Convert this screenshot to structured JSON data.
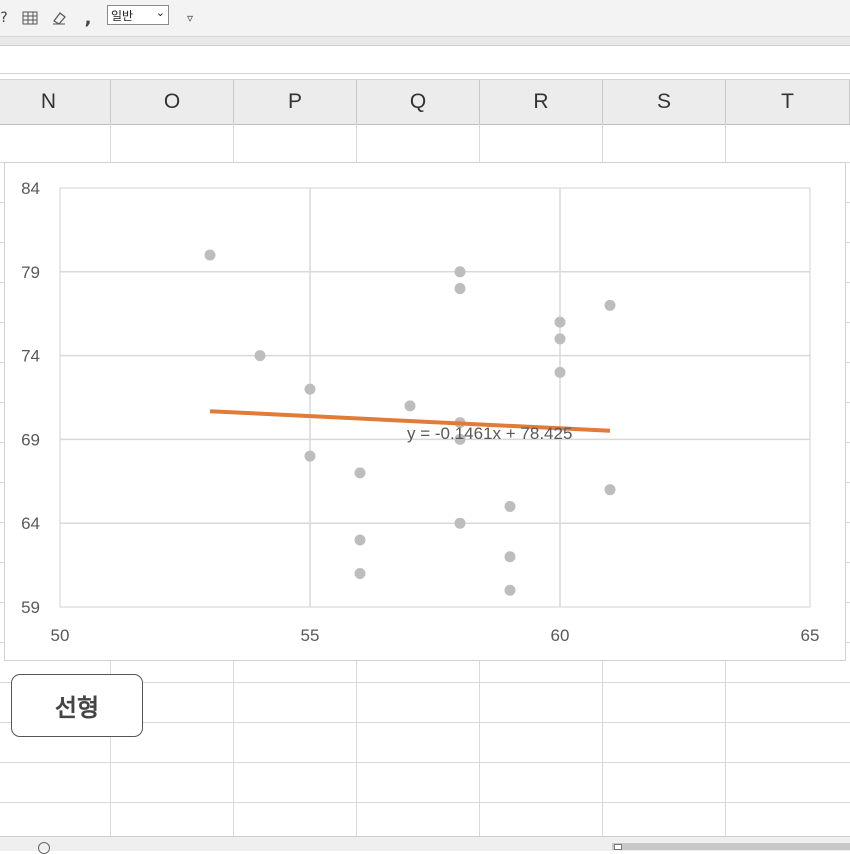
{
  "toolbar": {
    "icons": [
      "help-icon",
      "format-table-icon",
      "eraser-icon",
      "comma-style-icon"
    ],
    "comma_glyph": ",",
    "number_format": "일반",
    "more_icon": "▿"
  },
  "columns": [
    "N",
    "O",
    "P",
    "Q",
    "R",
    "S",
    "T"
  ],
  "button": {
    "label": "선형"
  },
  "chart_data": {
    "type": "scatter",
    "x_ticks": [
      "50",
      "55",
      "60",
      "65"
    ],
    "y_ticks": [
      "84",
      "79",
      "74",
      "69",
      "64",
      "59"
    ],
    "xlim": [
      50,
      65
    ],
    "ylim": [
      59,
      84
    ],
    "grid": true,
    "point_color": "#bdbdbd",
    "trendline_color": "#e07b39",
    "points": [
      {
        "x": 53,
        "y": 80
      },
      {
        "x": 54,
        "y": 74
      },
      {
        "x": 55,
        "y": 72
      },
      {
        "x": 55,
        "y": 68
      },
      {
        "x": 56,
        "y": 67
      },
      {
        "x": 56,
        "y": 63
      },
      {
        "x": 56,
        "y": 61
      },
      {
        "x": 57,
        "y": 71
      },
      {
        "x": 58,
        "y": 79
      },
      {
        "x": 58,
        "y": 78
      },
      {
        "x": 58,
        "y": 70
      },
      {
        "x": 58,
        "y": 69
      },
      {
        "x": 58,
        "y": 64
      },
      {
        "x": 59,
        "y": 65
      },
      {
        "x": 59,
        "y": 62
      },
      {
        "x": 59,
        "y": 60
      },
      {
        "x": 60,
        "y": 76
      },
      {
        "x": 60,
        "y": 75
      },
      {
        "x": 60,
        "y": 73
      },
      {
        "x": 61,
        "y": 77
      },
      {
        "x": 61,
        "y": 66
      }
    ],
    "trendline": {
      "slope": -0.1461,
      "intercept": 78.425,
      "x_start": 53,
      "x_end": 61,
      "equation": "y = -0.1461x + 78.425"
    }
  }
}
